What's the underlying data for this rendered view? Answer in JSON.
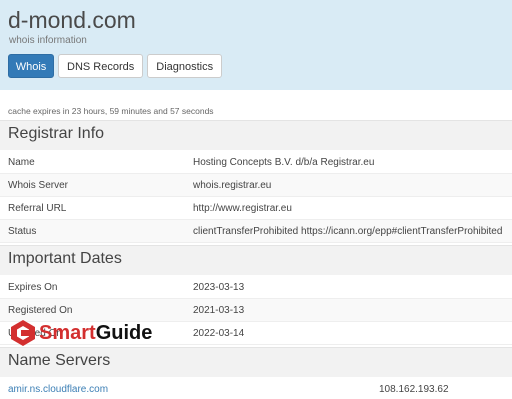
{
  "site": {
    "title": "d-mond.com",
    "subtitle": "whois information"
  },
  "tabs": [
    {
      "label": "Whois",
      "active": true
    },
    {
      "label": "DNS Records",
      "active": false
    },
    {
      "label": "Diagnostics",
      "active": false
    }
  ],
  "cache_text": "cache expires in 23 hours, 59 minutes and 57 seconds",
  "registrar": {
    "title": "Registrar Info",
    "rows": [
      {
        "key": "Name",
        "value": "Hosting Concepts B.V. d/b/a Registrar.eu"
      },
      {
        "key": "Whois Server",
        "value": "whois.registrar.eu"
      },
      {
        "key": "Referral URL",
        "value": "http://www.registrar.eu"
      },
      {
        "key": "Status",
        "value": "clientTransferProhibited https://icann.org/epp#clientTransferProhibited"
      }
    ]
  },
  "dates": {
    "title": "Important Dates",
    "rows": [
      {
        "key": "Expires On",
        "value": "2023-03-13"
      },
      {
        "key": "Registered On",
        "value": "2021-03-13"
      },
      {
        "key": "Updated On",
        "value": "2022-03-14"
      }
    ]
  },
  "nameservers": {
    "title": "Name Servers",
    "rows": [
      {
        "name": "amir.ns.cloudflare.com",
        "ip": "108.162.193.62"
      }
    ]
  },
  "watermark": {
    "text_a": "Smart",
    "text_b": "Guide"
  },
  "colors": {
    "header_bg": "#d9ebf5",
    "active_tab": "#337ab7",
    "link": "#3c7fb5",
    "watermark_red": "#d32f2f"
  }
}
